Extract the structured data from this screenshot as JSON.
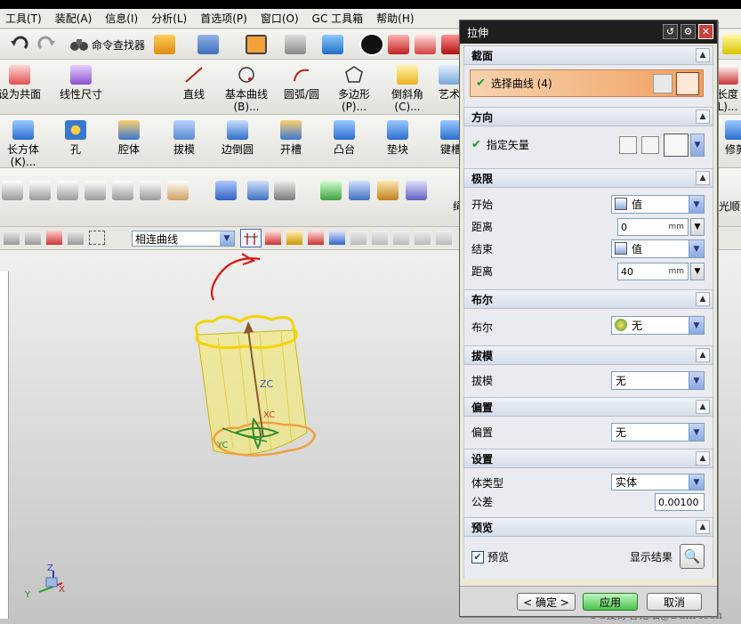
{
  "menubar": [
    "工具(T)",
    "装配(A)",
    "信息(I)",
    "分析(L)",
    "首选项(P)",
    "窗口(O)",
    "GC 工具箱",
    "帮助(H)"
  ],
  "toolbar1": {
    "command_finder": "命令查找器"
  },
  "toolbar2": [
    {
      "label": "设为共面"
    },
    {
      "label": "线性尺寸"
    },
    {
      "label": "直线"
    },
    {
      "label": "基本曲线\n(B)..."
    },
    {
      "label": "圆弧/圆"
    },
    {
      "label": "多边形\n(P)..."
    },
    {
      "label": "倒斜角\n(C)..."
    },
    {
      "label": "艺术"
    },
    {
      "label": "长度\nL)..."
    }
  ],
  "toolbar3": [
    {
      "label": "长方体\n(K)..."
    },
    {
      "label": "孔"
    },
    {
      "label": "腔体"
    },
    {
      "label": "拔模"
    },
    {
      "label": "边倒圆"
    },
    {
      "label": "开槽"
    },
    {
      "label": "凸台"
    },
    {
      "label": "垫块"
    },
    {
      "label": "键槽"
    },
    {
      "label": "修剪"
    }
  ],
  "toolbar4": {
    "right_label": "光顺",
    "mid_label": "绳"
  },
  "toolbar5": {
    "curve_rule": "相连曲线"
  },
  "dialog": {
    "title": "拉伸",
    "section": {
      "title": "截面",
      "select_curve": "选择曲线 (4)"
    },
    "direction": {
      "title": "方向",
      "specify_vector": "指定矢量"
    },
    "limits": {
      "title": "极限",
      "start_label": "开始",
      "start_value": "值",
      "distance1_label": "距离",
      "distance1_value": "0",
      "end_label": "结束",
      "end_value": "值",
      "distance2_label": "距离",
      "distance2_value": "40",
      "unit": "mm"
    },
    "boolean": {
      "title": "布尔",
      "label": "布尔",
      "value": "无"
    },
    "draft": {
      "title": "拔模",
      "label": "拔模",
      "value": "无"
    },
    "offset": {
      "title": "偏置",
      "label": "偏置",
      "value": "无"
    },
    "settings": {
      "title": "设置",
      "body_type_label": "体类型",
      "body_type_value": "实体",
      "tolerance_label": "公差",
      "tolerance_value": "0.00100"
    },
    "preview": {
      "title": "预览",
      "checkbox_label": "预览",
      "checked": true,
      "show_result": "显示结果"
    },
    "footer": {
      "ok": "< 确定 >",
      "apply": "应用",
      "cancel": "取消"
    }
  },
  "canvas": {
    "axis_labels": {
      "zc": "ZC",
      "xc": "XC",
      "yc": "YC"
    },
    "triad_labels": {
      "z": "Z",
      "x": "X",
      "y": "Y"
    }
  },
  "watermark": "UG爱好者论坛@Danresen",
  "colors": {
    "preview_body": "#f2ea7a",
    "profile": "#f5d400",
    "base_profile": "#f0a040",
    "sketch": "#2e8b2e",
    "arrow": "#8b5a2b",
    "dialog_title": "#1f1f1f",
    "highlight": "#f0a060"
  }
}
